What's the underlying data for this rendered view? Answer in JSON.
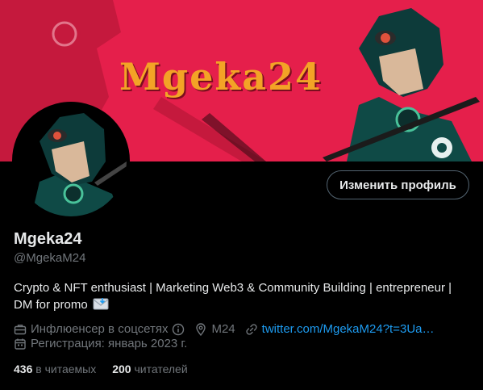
{
  "banner": {
    "title": "Mgeka24",
    "background_color": "#e51f4b",
    "title_color": "#f3a326"
  },
  "profile": {
    "edit_button_label": "Изменить профиль",
    "display_name": "Mgeka24",
    "handle": "@MgekaM24",
    "bio": "Crypto & NFT enthusiast | Marketing Web3 & Community Building | entrepreneur | DM for promo",
    "bio_emoji_icon": "envelope-emoji-icon",
    "category": "Инфлюенсер в соцсетях",
    "location": "M24",
    "website": "twitter.com/MgekaM24?t=3Ua…",
    "joined": "Регистрация: январь 2023 г.",
    "following_count": "436",
    "following_label": "в читаемых",
    "followers_count": "200",
    "followers_label": "читателей"
  },
  "colors": {
    "link": "#1d9bf0",
    "muted": "#71767b",
    "text": "#e7e9ea",
    "background": "#000000"
  },
  "icons": [
    "briefcase-icon",
    "info-icon",
    "location-pin-icon",
    "link-icon",
    "calendar-icon"
  ]
}
